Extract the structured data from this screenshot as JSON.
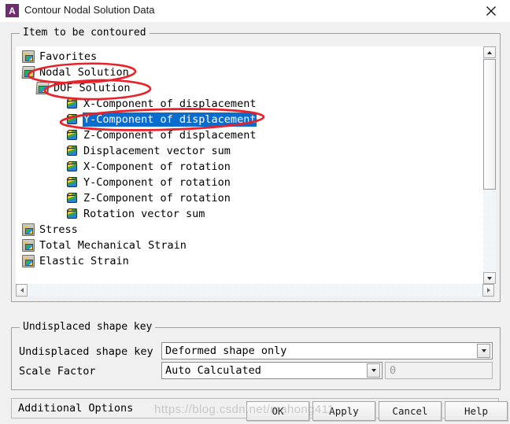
{
  "window": {
    "title": "Contour Nodal Solution Data",
    "app_icon_letter": "A",
    "app_icon_color": "#6d2d6e",
    "close_icon": "close-icon"
  },
  "item_group": {
    "legend": "Item to be contoured",
    "tree": [
      {
        "label": "Favorites",
        "icon": "folder-icon",
        "depth": 0,
        "selected": false
      },
      {
        "label": "Nodal Solution",
        "icon": "folder-open-icon",
        "depth": 0,
        "selected": false
      },
      {
        "label": "DOF Solution",
        "icon": "folder-open-icon",
        "depth": 1,
        "selected": false
      },
      {
        "label": "X-Component of displacement",
        "icon": "cube-icon",
        "depth": 2,
        "selected": false
      },
      {
        "label": "Y-Component of displacement",
        "icon": "cube-icon",
        "depth": 2,
        "selected": true
      },
      {
        "label": "Z-Component of displacement",
        "icon": "cube-icon",
        "depth": 2,
        "selected": false
      },
      {
        "label": "Displacement vector sum",
        "icon": "cube-icon",
        "depth": 2,
        "selected": false
      },
      {
        "label": "X-Component of rotation",
        "icon": "cube-icon",
        "depth": 2,
        "selected": false
      },
      {
        "label": "Y-Component of rotation",
        "icon": "cube-icon",
        "depth": 2,
        "selected": false
      },
      {
        "label": "Z-Component of rotation",
        "icon": "cube-icon",
        "depth": 2,
        "selected": false
      },
      {
        "label": "Rotation vector sum",
        "icon": "cube-icon",
        "depth": 2,
        "selected": false
      },
      {
        "label": "Stress",
        "icon": "folder-icon",
        "depth": 0,
        "selected": false
      },
      {
        "label": "Total Mechanical Strain",
        "icon": "folder-icon",
        "depth": 0,
        "selected": false
      },
      {
        "label": "Elastic Strain",
        "icon": "folder-icon",
        "depth": 0,
        "selected": false
      }
    ],
    "selection_color": "#0a6ccd",
    "scrollbar_vertical": {
      "up_icon": "scroll-up-icon",
      "down_icon": "scroll-down-icon"
    },
    "scrollbar_horizontal": {
      "left_icon": "scroll-left-icon",
      "right_icon": "scroll-right-icon"
    }
  },
  "undisplaced_group": {
    "legend": "Undisplaced shape key",
    "rows": [
      {
        "label": "Undisplaced shape key",
        "value": "Deformed shape only"
      },
      {
        "label": "Scale Factor",
        "value": "Auto Calculated",
        "extra_value": "0"
      }
    ]
  },
  "additional_options": {
    "label": "Additional Options",
    "expand_icon": "chevron-double-down-circle-icon"
  },
  "buttons": [
    {
      "label": "OK",
      "name": "ok-button",
      "disabled": false
    },
    {
      "label": "Apply",
      "name": "apply-button",
      "disabled": false
    },
    {
      "label": "Cancel",
      "name": "cancel-button",
      "disabled": false
    },
    {
      "label": "Help",
      "name": "help-button",
      "disabled": false
    }
  ],
  "annotations": {
    "color": "#e8212a",
    "ovals": [
      {
        "label": "Nodal Solution"
      },
      {
        "label": "DOF Solution"
      },
      {
        "label": "Y-Component of displacement"
      }
    ]
  },
  "watermark": {
    "text": "https://blog.csdn.net/mahong411"
  }
}
